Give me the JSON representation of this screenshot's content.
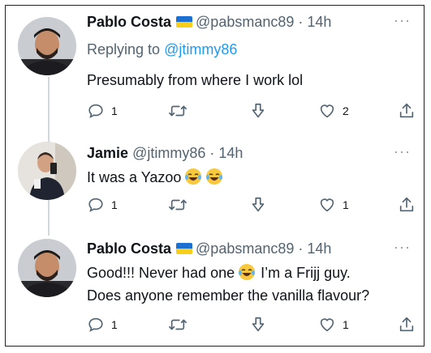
{
  "tweets": [
    {
      "name": "Pablo Costa",
      "handle": "@pabsmanc89",
      "time": "14h",
      "replying_prefix": "Replying to",
      "replying_to": "@jtimmy86",
      "text": "Presumably from where I work lol",
      "flag": "ukraine-flag",
      "avatar_icon": "man-avatar",
      "reply_count": "1",
      "retweet_count": "",
      "like_count": "2"
    },
    {
      "name": "Jamie",
      "handle": "@jtimmy86",
      "time": "14h",
      "text": "It was a Yazoo",
      "emojis": [
        "laughing-face-emoji",
        "laughing-face-emoji"
      ],
      "avatar_icon": "selfie-avatar",
      "reply_count": "1",
      "retweet_count": "",
      "like_count": "1"
    },
    {
      "name": "Pablo Costa",
      "handle": "@pabsmanc89",
      "time": "14h",
      "text_line1_a": "Good!!! Never had one",
      "text_line1_b": "I’m a Frijj guy.",
      "text_line2": "Does anyone remember the vanilla flavour?",
      "flag": "ukraine-flag",
      "emojis": [
        "laughing-face-emoji"
      ],
      "avatar_icon": "man-avatar",
      "reply_count": "1",
      "retweet_count": "",
      "like_count": "1"
    }
  ],
  "separator": "·",
  "more_icon": "more-options-icon",
  "colors": {
    "link": "#1d9bf0",
    "secondary_text": "#536471",
    "primary_text": "#0f1419",
    "thread_line": "#cfd9de"
  }
}
